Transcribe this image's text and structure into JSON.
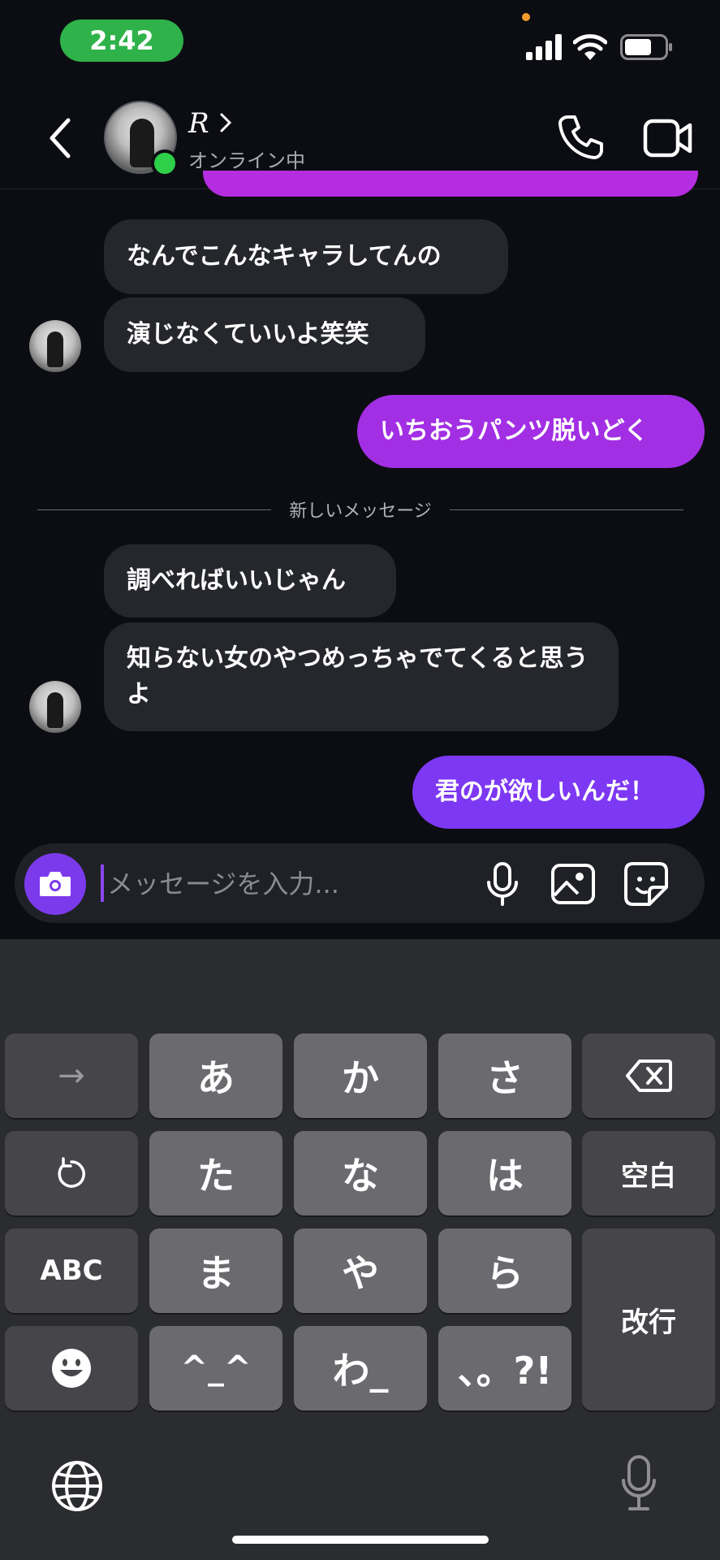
{
  "status_bar": {
    "time": "2:42"
  },
  "header": {
    "contact_name": "R",
    "contact_status": "オンライン中"
  },
  "messages": [
    {
      "direction": "in",
      "text": "なんでこんなキャラしてんの"
    },
    {
      "direction": "in",
      "text": "演じなくていいよ笑笑"
    },
    {
      "direction": "out",
      "text": "いちおうパンツ脱いどく"
    },
    {
      "direction": "in",
      "text": "調べればいいじゃん"
    },
    {
      "direction": "in",
      "text": "知らない女のやつめっちゃでてくると思うよ"
    },
    {
      "direction": "out",
      "text": "君のが欲しいんだ！"
    }
  ],
  "new_messages_divider": "新しいメッセージ",
  "composer": {
    "placeholder": "メッセージを入力..."
  },
  "keyboard": {
    "rows": [
      [
        "→",
        "あ",
        "か",
        "さ",
        "⌫"
      ],
      [
        "↺",
        "た",
        "な",
        "は",
        "空白"
      ],
      [
        "ABC",
        "ま",
        "や",
        "ら",
        "改行"
      ],
      [
        "☻",
        "^_^",
        "わ_",
        "、。?!"
      ]
    ]
  },
  "colors": {
    "accent": "#7c3aed",
    "outgoing_bubble_1": "#a22fe4",
    "outgoing_bubble_2": "#7d38f3",
    "incoming_bubble": "#25272d",
    "online": "#2ed04a",
    "status_time_bg": "#2fb24a"
  },
  "icons": [
    "back-icon",
    "chevron-right-icon",
    "phone-icon",
    "video-icon",
    "camera-icon",
    "microphone-icon",
    "image-icon",
    "sticker-icon",
    "globe-icon",
    "delete-icon",
    "undo-icon",
    "emoji-icon"
  ]
}
